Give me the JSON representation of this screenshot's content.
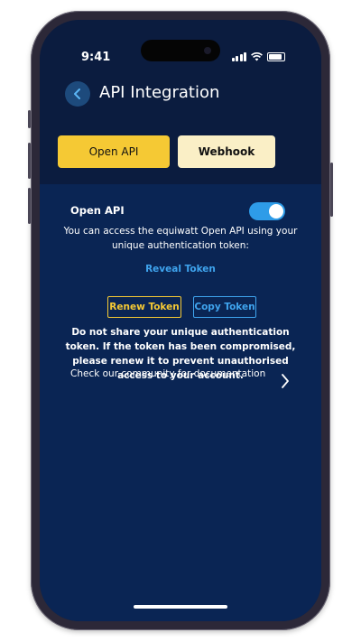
{
  "status_bar": {
    "time": "9:41"
  },
  "header": {
    "title": "API Integration",
    "back_icon": "chevron-left-icon"
  },
  "tabs": [
    {
      "label": "Open API",
      "active": true
    },
    {
      "label": "Webhook",
      "active": false
    }
  ],
  "open_api": {
    "label": "Open API",
    "toggle_on": true,
    "description": "You can access the equiwatt Open API using your unique authentication token:",
    "reveal_label": "Reveal Token",
    "renew_label": "Renew Token",
    "copy_label": "Copy Token",
    "warning": "Do not share your unique authentication token. If the token has been compromised, please renew it to prevent unauthorised access to your account.",
    "community_text": "Check our community for documentation"
  },
  "colors": {
    "accent_yellow": "#f5c934",
    "accent_blue": "#3fa4ee",
    "header_bg": "#0b1c3f",
    "content_bg": "#0a2554"
  }
}
